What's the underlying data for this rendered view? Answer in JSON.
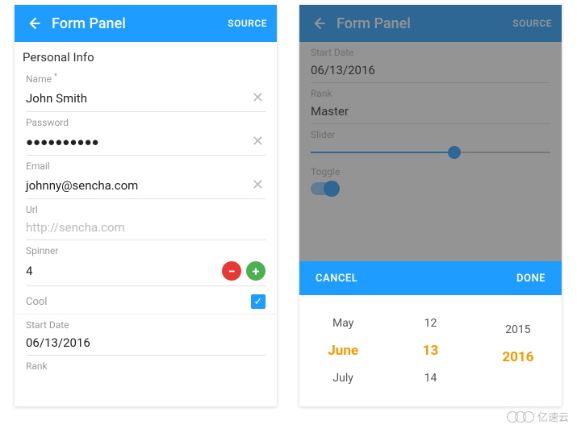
{
  "header": {
    "title": "Form Panel",
    "source": "SOURCE"
  },
  "left": {
    "section_title": "Personal Info",
    "name": {
      "label": "Name",
      "required_mark": "*",
      "value": "John Smith"
    },
    "password": {
      "label": "Password",
      "value": "●●●●●●●●●●"
    },
    "email": {
      "label": "Email",
      "value": "johnny@sencha.com"
    },
    "url": {
      "label": "Url",
      "placeholder": "http://sencha.com"
    },
    "spinner": {
      "label": "Spinner",
      "value": "4"
    },
    "cool": {
      "label": "Cool",
      "checked": true
    },
    "start_date": {
      "label": "Start Date",
      "value": "06/13/2016"
    },
    "rank": {
      "label": "Rank"
    }
  },
  "right": {
    "start_date": {
      "label": "Start Date",
      "value": "06/13/2016"
    },
    "rank": {
      "label": "Rank",
      "value": "Master"
    },
    "slider": {
      "label": "Slider",
      "percent": 60
    },
    "toggle": {
      "label": "Toggle",
      "on": true
    },
    "picker_actions": {
      "cancel": "CANCEL",
      "done": "DONE"
    },
    "picker": {
      "months": {
        "prev": "May",
        "sel": "June",
        "next": "July"
      },
      "days": {
        "prev": "12",
        "sel": "13",
        "next": "14"
      },
      "years": {
        "prev": "2015",
        "sel": "2016",
        "next": ""
      }
    }
  },
  "watermark": "亿速云"
}
